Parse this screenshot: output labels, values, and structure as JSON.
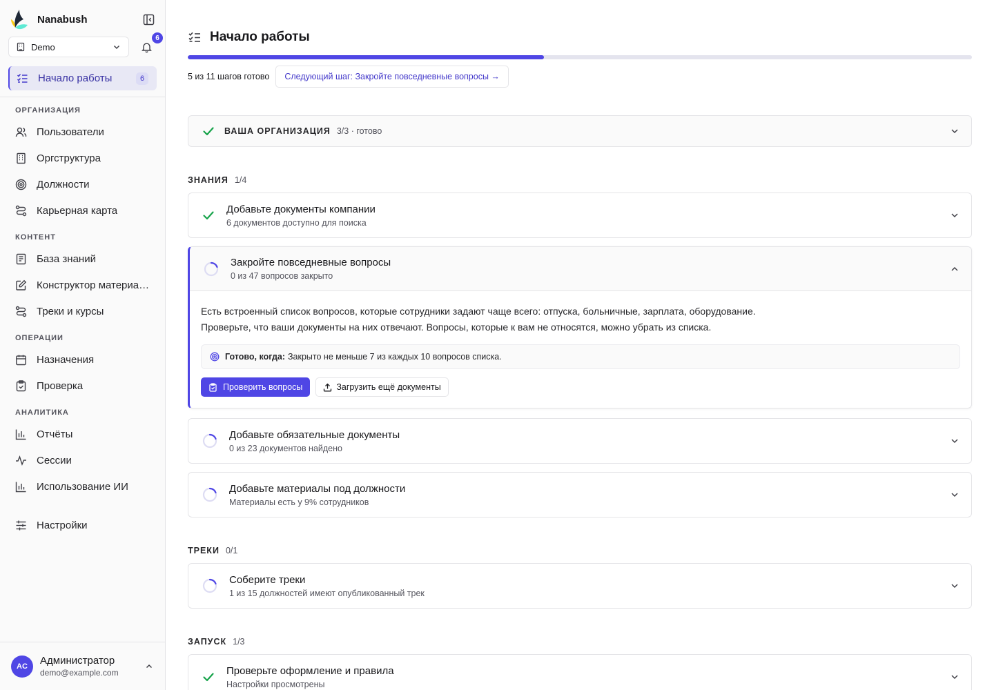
{
  "brand": {
    "name": "Nanabush"
  },
  "workspace": {
    "label": "Demo"
  },
  "notifications": {
    "count": "6"
  },
  "sidebar": {
    "active": {
      "label": "Начало работы",
      "count": "6"
    },
    "sections": [
      {
        "title": "ОРГАНИЗАЦИЯ",
        "items": [
          {
            "label": "Пользователи",
            "icon": "users-icon"
          },
          {
            "label": "Оргструктура",
            "icon": "building-icon"
          },
          {
            "label": "Должности",
            "icon": "target-icon"
          },
          {
            "label": "Карьерная карта",
            "icon": "route-icon"
          }
        ]
      },
      {
        "title": "КОНТЕНТ",
        "items": [
          {
            "label": "База знаний",
            "icon": "book-icon"
          },
          {
            "label": "Конструктор материалов",
            "icon": "edit-icon"
          },
          {
            "label": "Треки и курсы",
            "icon": "route-icon"
          }
        ]
      },
      {
        "title": "ОПЕРАЦИИ",
        "items": [
          {
            "label": "Назначения",
            "icon": "calendar-icon"
          },
          {
            "label": "Проверка",
            "icon": "clipboard-check-icon"
          }
        ]
      },
      {
        "title": "АНАЛИТИКА",
        "items": [
          {
            "label": "Отчёты",
            "icon": "bar-chart-icon"
          },
          {
            "label": "Сессии",
            "icon": "activity-icon"
          },
          {
            "label": "Использование ИИ",
            "icon": "bar-chart-icon"
          }
        ]
      }
    ],
    "settings": {
      "label": "Настройки",
      "icon": "sliders-icon"
    }
  },
  "user": {
    "initials": "AC",
    "name": "Администратор",
    "email": "demo@example.com"
  },
  "page": {
    "title": "Начало работы",
    "progress": {
      "done": 5,
      "total": 11
    },
    "status_text": "5 из 11 шагов готово",
    "next_step_label": "Следующий шаг: Закройте повседневные вопросы →"
  },
  "org_section": {
    "title": "ВАША ОРГАНИЗАЦИЯ",
    "subtitle": "3/3 · готово"
  },
  "groups": {
    "knowledge": {
      "title": "ЗНАНИЯ",
      "count": "1/4"
    },
    "tracks": {
      "title": "ТРЕКИ",
      "count": "0/1"
    },
    "launch": {
      "title": "ЗАПУСК",
      "count": "1/3"
    }
  },
  "steps": {
    "docs": {
      "title": "Добавьте документы компании",
      "subtitle": "6 документов доступно для поиска"
    },
    "questions": {
      "title": "Закройте повседневные вопросы",
      "subtitle": "0 из 47 вопросов закрыто",
      "desc_line1": "Есть встроенный список вопросов, которые сотрудники задают чаще всего: отпуска, больничные, зарплата, оборудование.",
      "desc_line2": "Проверьте, что ваши документы на них отвечают. Вопросы, которые к вам не относятся, можно убрать из списка.",
      "done_when_label": "Готово, когда:",
      "done_when_text": "Закрыто не меньше 7 из каждых 10 вопросов списка.",
      "primary_button": "Проверить вопросы",
      "secondary_button": "Загрузить ещё документы"
    },
    "required_docs": {
      "title": "Добавьте обязательные документы",
      "subtitle": "0 из 23 документов найдено"
    },
    "role_materials": {
      "title": "Добавьте материалы под должности",
      "subtitle": "Материалы есть у 9% сотрудников"
    },
    "tracks": {
      "title": "Соберите треки",
      "subtitle": "1 из 15 должностей имеют опубликованный трек"
    },
    "branding": {
      "title": "Проверьте оформление и правила",
      "subtitle": "Настройки просмотрены"
    }
  },
  "colors": {
    "accent": "#4f46e5",
    "success": "#16a34a",
    "border": "#e4e4e7"
  }
}
